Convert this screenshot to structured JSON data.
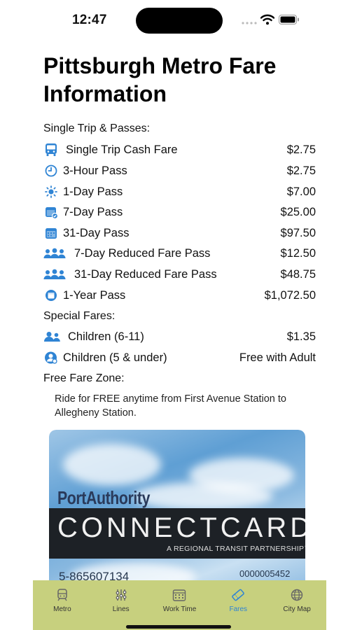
{
  "status": {
    "time": "12:47"
  },
  "page_title": "Pittsburgh Metro Fare Information",
  "sections": {
    "single": "Single Trip & Passes:",
    "special": "Special Fares:",
    "free_zone": "Free Fare Zone:"
  },
  "fares": [
    {
      "label": "Single Trip Cash Fare",
      "price": "$2.75",
      "icon": "bus-icon"
    },
    {
      "label": "3-Hour Pass",
      "price": "$2.75",
      "icon": "clock-icon"
    },
    {
      "label": "1-Day Pass",
      "price": "$7.00",
      "icon": "sun-icon"
    },
    {
      "label": "7-Day Pass",
      "price": "$25.00",
      "icon": "calendar-check-icon"
    },
    {
      "label": "31-Day Pass",
      "price": "$97.50",
      "icon": "calendar-icon"
    },
    {
      "label": "7-Day Reduced Fare Pass",
      "price": "$12.50",
      "icon": "group-icon"
    },
    {
      "label": "31-Day Reduced Fare Pass",
      "price": "$48.75",
      "icon": "group-icon"
    },
    {
      "label": "1-Year Pass",
      "price": "$1,072.50",
      "icon": "calendar-circle-icon"
    }
  ],
  "special_fares": [
    {
      "label": "Children (6-11)",
      "price": "$1.35",
      "icon": "children-icon"
    },
    {
      "label": "Children (5 & under)",
      "price": "Free with Adult",
      "icon": "child-circle-icon"
    }
  ],
  "free_zone_text": "Ride for FREE anytime from First Avenue Station to Allegheny Station.",
  "card": {
    "brand": "PortAuthority",
    "name": "CONNECTCARD",
    "tagline": "A REGIONAL TRANSIT PARTNERSHIP™",
    "number_left": "5-865607134",
    "number_right": "0000005452"
  },
  "tabs": [
    {
      "label": "Metro",
      "icon": "train-icon",
      "active": false
    },
    {
      "label": "Lines",
      "icon": "lines-icon",
      "active": false
    },
    {
      "label": "Work Time",
      "icon": "calendar-grid-icon",
      "active": false
    },
    {
      "label": "Fares",
      "icon": "ticket-icon",
      "active": true
    },
    {
      "label": "City Map",
      "icon": "globe-icon",
      "active": false
    }
  ],
  "colors": {
    "accent": "#2f84d4",
    "tabbar_bg": "#c7d07e"
  }
}
